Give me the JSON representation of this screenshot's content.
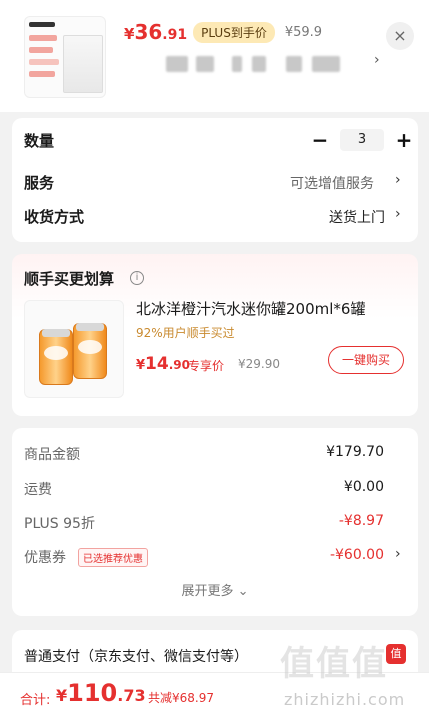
{
  "header": {
    "price_symbol": "¥",
    "price_int": "36",
    "price_dec": ".91",
    "plus_tag": "PLUS到手价",
    "orig_price": "¥59.9",
    "close_icon": "×",
    "chevron": "›"
  },
  "options": {
    "quantity_label": "数量",
    "quantity_minus": "−",
    "quantity_value": "3",
    "quantity_plus": "+",
    "service_label": "服务",
    "service_value": "可选增值服务",
    "delivery_label": "收货方式",
    "delivery_value": "送货上门",
    "chevron": "›"
  },
  "addon": {
    "title": "顺手买更划算",
    "info_icon": "i",
    "product_name": "北冰洋橙汁汽水迷你罐200ml*6罐",
    "product_sub": "92%用户顺手买过",
    "price_symbol": "¥",
    "price_int": "14",
    "price_dec": ".90",
    "exclusive_label": "专享价",
    "orig_price": "¥29.90",
    "buy_button": "一键购买"
  },
  "fees": {
    "goods_label": "商品金额",
    "goods_value": "¥179.70",
    "shipping_label": "运费",
    "shipping_value": "¥0.00",
    "plus_label": "PLUS 95折",
    "plus_value": "-¥8.97",
    "coupon_label": "优惠券",
    "coupon_tag": "已选推荐优惠",
    "coupon_value": "-¥60.00",
    "chevron": "›",
    "expand_label": "展开更多 ⌄"
  },
  "payment": {
    "label": "普通支付（京东支付、微信支付等）",
    "icon": "值"
  },
  "bottom": {
    "total_label": "合计:",
    "total_symbol": "¥",
    "total_int": "110",
    "total_dec": ".73",
    "saving": "共减¥68.97"
  },
  "watermark": {
    "logo": "值值值",
    "site": "zhizhizhi.com"
  },
  "colors": {
    "accent": "#e5302f",
    "plus_gold": "#fde9b5"
  }
}
